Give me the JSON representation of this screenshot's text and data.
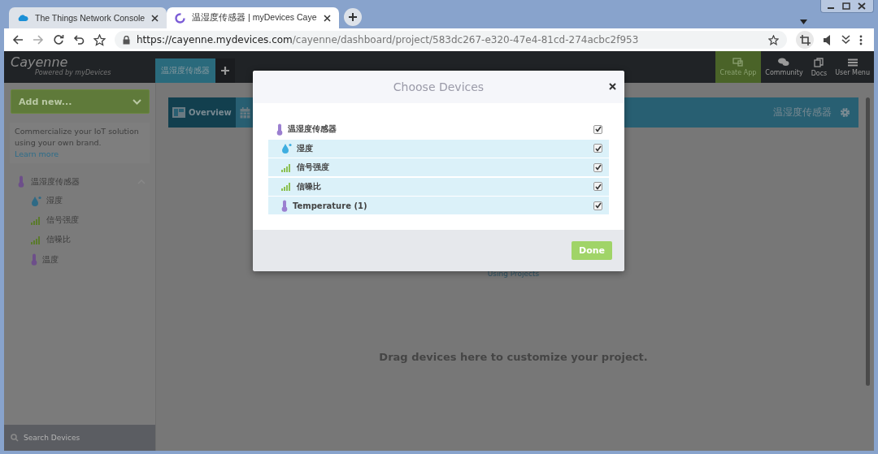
{
  "browser": {
    "tabs": [
      {
        "title": "The Things Network Console",
        "kind": "cloud",
        "selected": false
      },
      {
        "title": "温湿度传感器 | myDevices Caye",
        "kind": "cayenne",
        "selected": true
      }
    ],
    "url": {
      "host": "https://cayenne.mydevices.com",
      "path": "/cayenne/dashboard/project/583dc267-e320-47e4-81cd-274acbc2f953"
    }
  },
  "app": {
    "logo": "Cayenne",
    "tagline": "Powered by myDevices",
    "project_tabs": [
      {
        "label": "温湿度传感器",
        "selected": true
      }
    ],
    "nav": [
      {
        "label": "Create App",
        "kind": "apps",
        "selected": true
      },
      {
        "label": "Community",
        "kind": "chat",
        "selected": false
      },
      {
        "label": "Docs",
        "kind": "docs",
        "selected": false
      },
      {
        "label": "User Menu",
        "kind": "menu",
        "selected": false
      }
    ]
  },
  "sidebar": {
    "add_button": "Add new...",
    "promo": "Commercialize your IoT solution using your own brand.",
    "promo_link": "Learn more",
    "devices": [
      {
        "name": "温湿度传感器",
        "kind": "thermometer",
        "expanded": true,
        "children": [
          {
            "name": "湿度",
            "kind": "drop"
          },
          {
            "name": "信号强度",
            "kind": "signal"
          },
          {
            "name": "信噪比",
            "kind": "signal"
          },
          {
            "name": "温度",
            "kind": "thermometer"
          }
        ]
      }
    ],
    "search": {
      "placeholder": "Search Devices"
    }
  },
  "main": {
    "tabs": [
      {
        "label": "Overview",
        "kind": "layout",
        "selected": true
      },
      {
        "kind": "calendar",
        "selected": false
      }
    ],
    "project_title": "温湿度传感器",
    "hint_link": "Using Projects",
    "empty_text": "Drag devices here to customize your project."
  },
  "modal": {
    "title": "Choose Devices",
    "items": [
      {
        "name": "温湿度传感器",
        "kind": "thermometer",
        "checked": true,
        "children": [
          {
            "name": "湿度",
            "kind": "drop",
            "checked": true
          },
          {
            "name": "信号强度",
            "kind": "signal",
            "checked": true
          },
          {
            "name": "信噪比",
            "kind": "signal",
            "checked": true
          },
          {
            "name": "Temperature (1)",
            "kind": "thermometer",
            "checked": true
          }
        ]
      }
    ],
    "done": "Done"
  }
}
